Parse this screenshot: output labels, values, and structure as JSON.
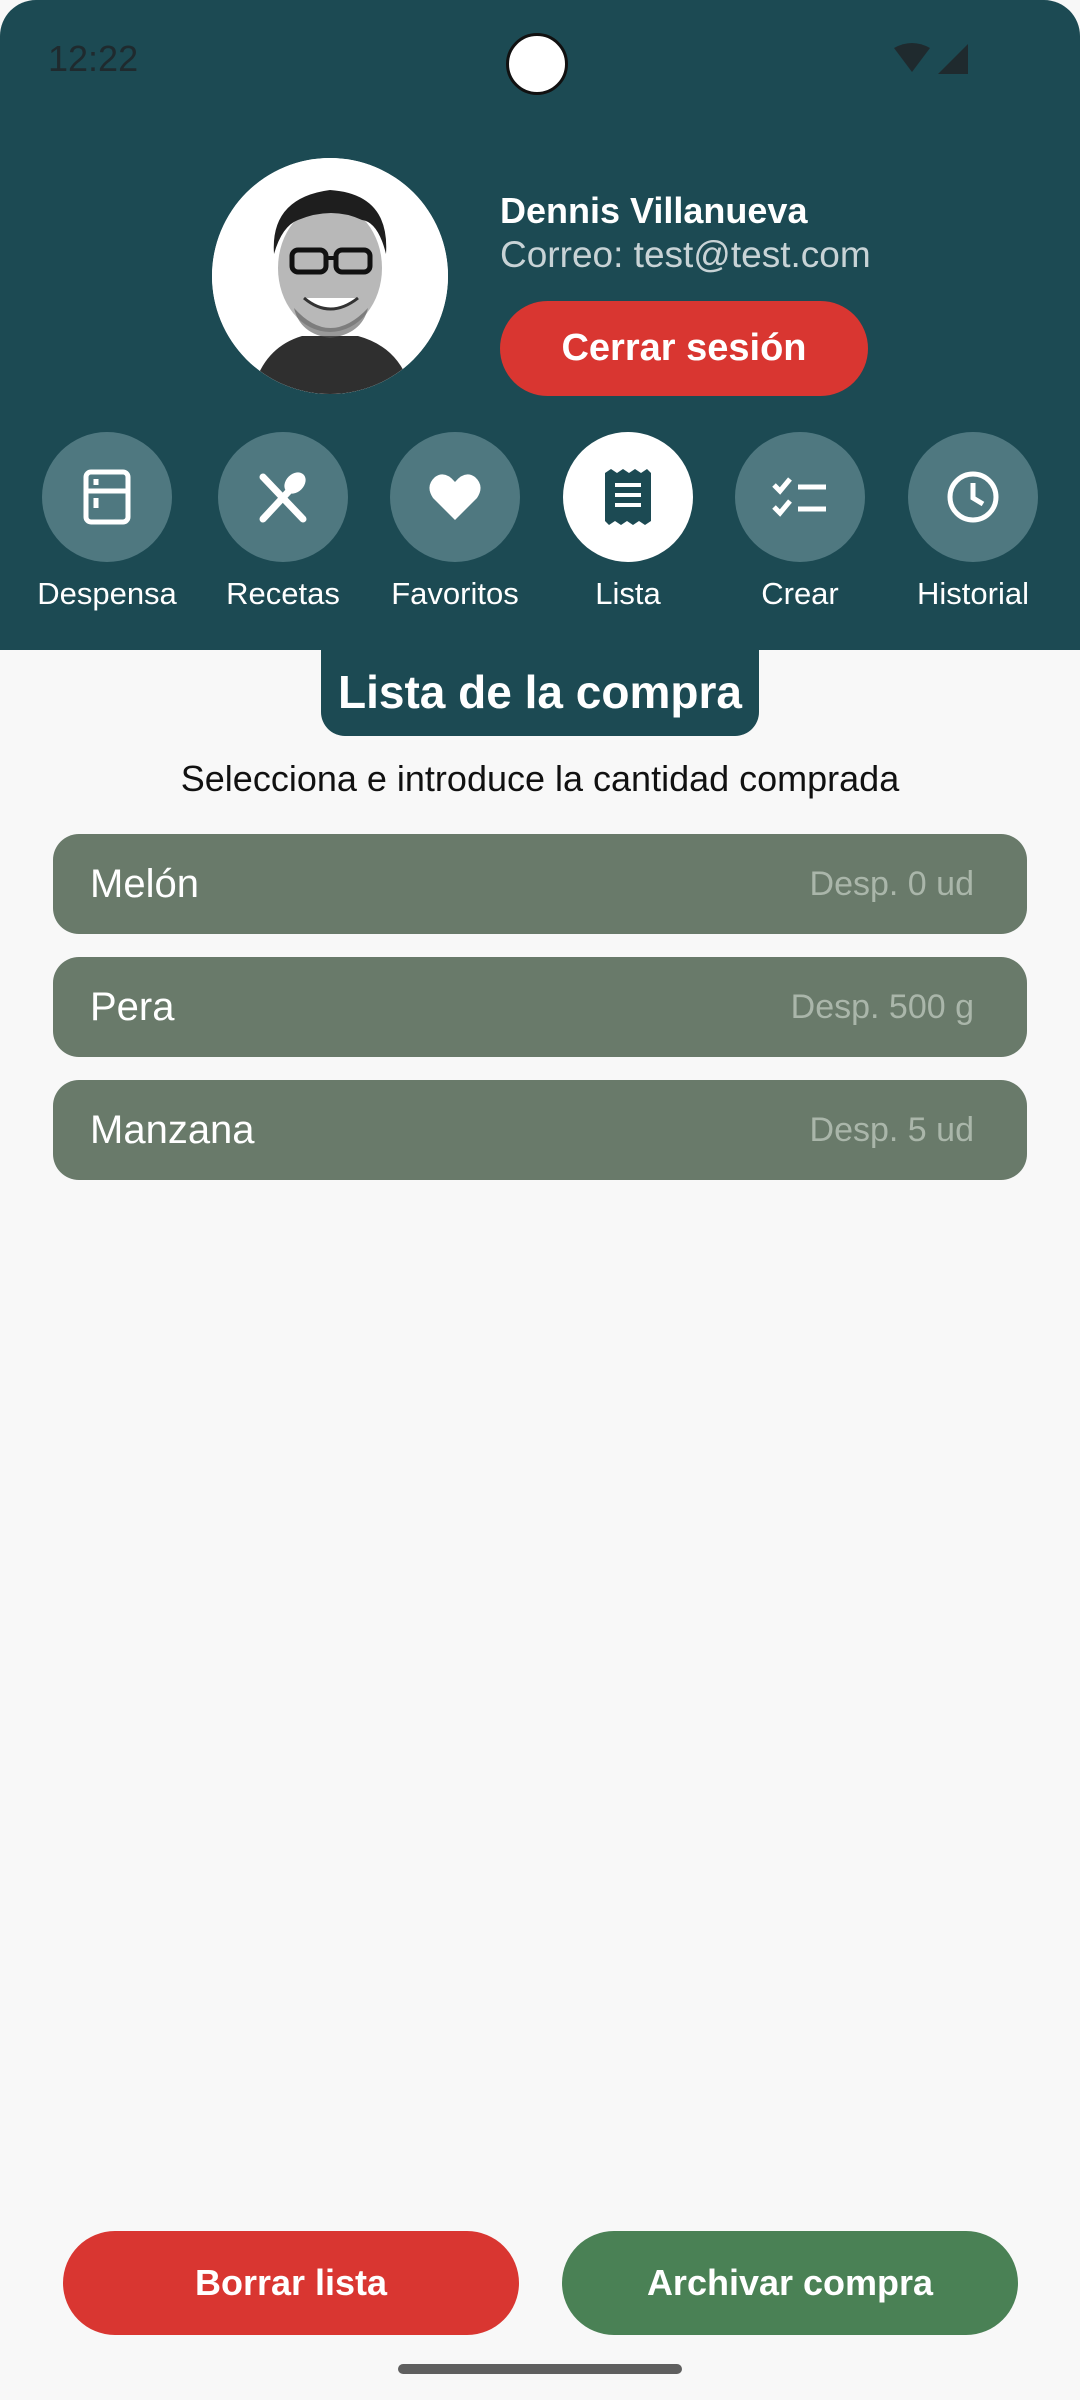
{
  "status_bar": {
    "time": "12:22"
  },
  "profile": {
    "name": "Dennis Villanueva",
    "email_label": "Correo:",
    "email": "test@test.com",
    "logout_label": "Cerrar sesión"
  },
  "nav": [
    {
      "label": "Despensa",
      "icon": "fridge-icon",
      "active": false
    },
    {
      "label": "Recetas",
      "icon": "utensils-icon",
      "active": false
    },
    {
      "label": "Favoritos",
      "icon": "heart-icon",
      "active": false
    },
    {
      "label": "Lista",
      "icon": "receipt-icon",
      "active": true
    },
    {
      "label": "Crear",
      "icon": "checklist-icon",
      "active": false
    },
    {
      "label": "Historial",
      "icon": "clock-icon",
      "active": false
    }
  ],
  "section": {
    "title": "Lista de la compra",
    "instruction": "Selecciona e introduce la cantidad comprada"
  },
  "items": [
    {
      "name": "Melón",
      "stock": "Desp. 0 ud"
    },
    {
      "name": "Pera",
      "stock": "Desp. 500 g"
    },
    {
      "name": "Manzana",
      "stock": "Desp. 5 ud"
    }
  ],
  "actions": {
    "clear_label": "Borrar lista",
    "archive_label": "Archivar compra"
  },
  "colors": {
    "header": "#1c4a53",
    "danger": "#d93631",
    "success": "#4a8155",
    "item": "#697a6a"
  }
}
